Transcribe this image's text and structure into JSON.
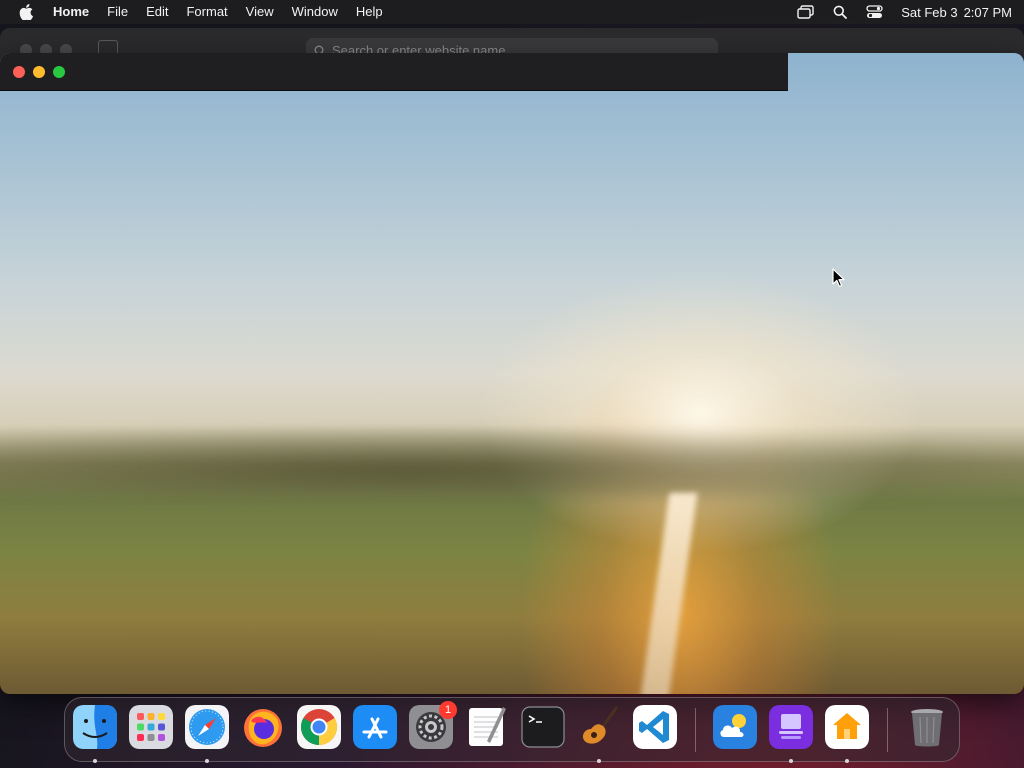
{
  "menubar": {
    "app_name": "Home",
    "menus": [
      "File",
      "Edit",
      "Format",
      "View",
      "Window",
      "Help"
    ],
    "clock": {
      "date": "Sat Feb 3",
      "time": "2:07 PM"
    }
  },
  "background_window": {
    "address_placeholder": "Search or enter website name"
  },
  "dock": {
    "apps": [
      {
        "name": "Finder",
        "icon": "finder-icon",
        "running": true
      },
      {
        "name": "Launchpad",
        "icon": "launchpad-icon",
        "running": false
      },
      {
        "name": "Safari",
        "icon": "safari-icon",
        "running": true
      },
      {
        "name": "Firefox",
        "icon": "firefox-icon",
        "running": false
      },
      {
        "name": "Chrome",
        "icon": "chrome-icon",
        "running": false
      },
      {
        "name": "App Store",
        "icon": "app-store-icon",
        "running": false
      },
      {
        "name": "System Settings",
        "icon": "system-settings-icon",
        "running": false,
        "badge": "1"
      },
      {
        "name": "TextEdit",
        "icon": "textedit-icon",
        "running": false
      },
      {
        "name": "Terminal",
        "icon": "terminal-icon",
        "running": false
      },
      {
        "name": "GarageBand",
        "icon": "garageband-icon",
        "running": true
      },
      {
        "name": "Visual Studio Code",
        "icon": "vscode-icon",
        "running": false
      },
      {
        "name": "Weather",
        "icon": "weather-icon",
        "running": false
      },
      {
        "name": "Apple Configurator",
        "icon": "configurator-icon",
        "running": true
      },
      {
        "name": "Home",
        "icon": "home-app-icon",
        "running": true
      },
      {
        "name": "Trash",
        "icon": "trash-icon",
        "running": false
      }
    ]
  },
  "colors": {
    "close": "#fe5f57",
    "minimize": "#febc2e",
    "zoom": "#28c840",
    "badge": "#ff3b30"
  }
}
